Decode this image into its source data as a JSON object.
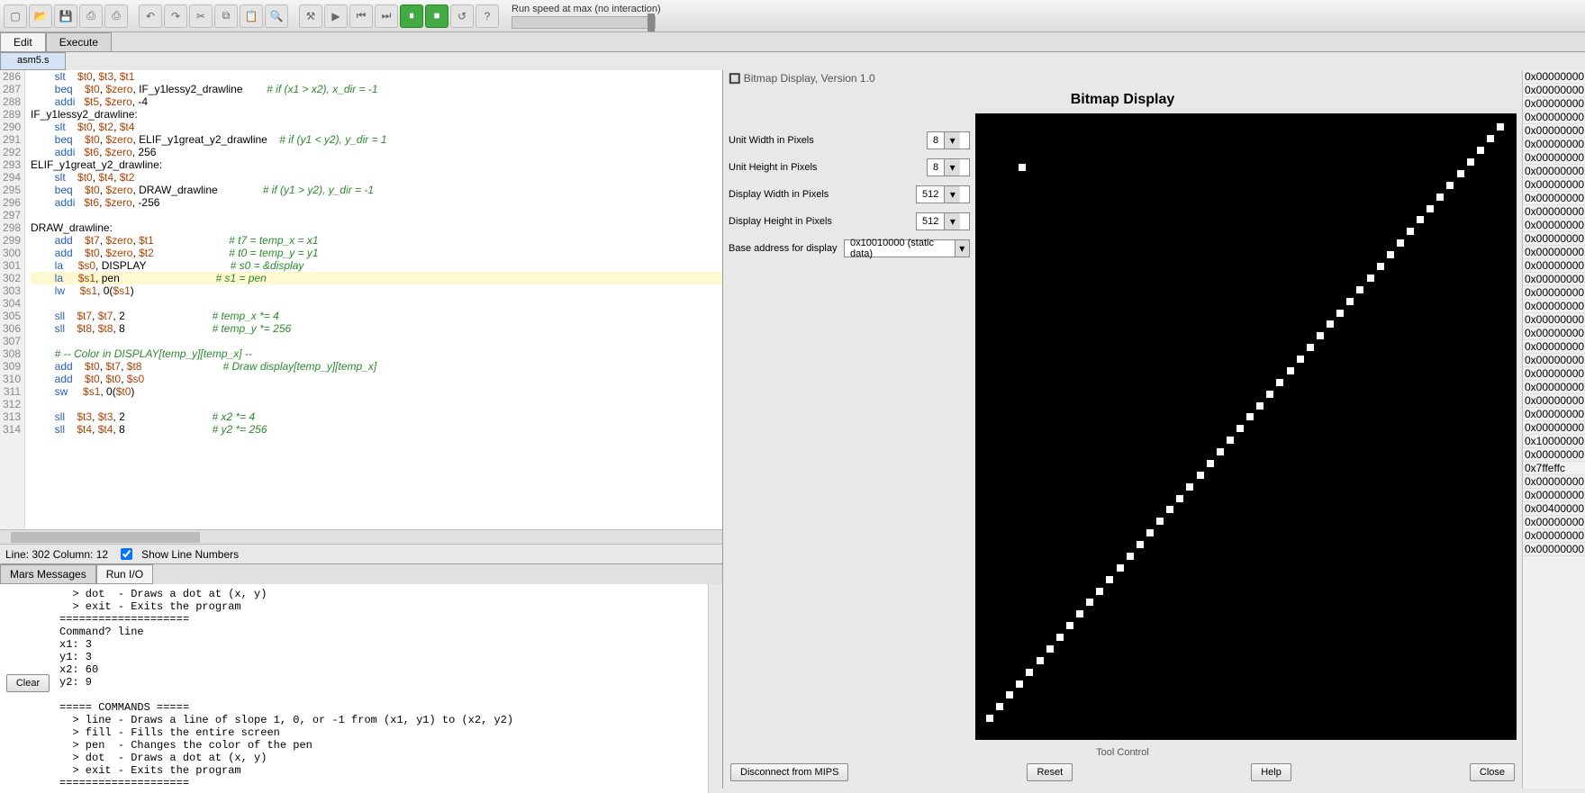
{
  "toolbar": {
    "speed_label": "Run speed at max (no interaction)"
  },
  "tabs": {
    "edit": "Edit",
    "execute": "Execute",
    "file": "asm5.s"
  },
  "editor": {
    "lines": [
      {
        "n": 286,
        "t": "        slt    $t0, $t3, $t1"
      },
      {
        "n": 287,
        "t": "        beq    $t0, $zero, IF_y1lessy2_drawline        # if (x1 > x2), x_dir = -1"
      },
      {
        "n": 288,
        "t": "        addi   $t5, $zero, -4"
      },
      {
        "n": 289,
        "t": "IF_y1lessy2_drawline:"
      },
      {
        "n": 290,
        "t": "        slt    $t0, $t2, $t4"
      },
      {
        "n": 291,
        "t": "        beq    $t0, $zero, ELIF_y1great_y2_drawline    # if (y1 < y2), y_dir = 1"
      },
      {
        "n": 292,
        "t": "        addi   $t6, $zero, 256"
      },
      {
        "n": 293,
        "t": "ELIF_y1great_y2_drawline:"
      },
      {
        "n": 294,
        "t": "        slt    $t0, $t4, $t2"
      },
      {
        "n": 295,
        "t": "        beq    $t0, $zero, DRAW_drawline               # if (y1 > y2), y_dir = -1"
      },
      {
        "n": 296,
        "t": "        addi   $t6, $zero, -256"
      },
      {
        "n": 297,
        "t": ""
      },
      {
        "n": 298,
        "t": "DRAW_drawline:"
      },
      {
        "n": 299,
        "t": "        add    $t7, $zero, $t1                         # t7 = temp_x = x1"
      },
      {
        "n": 300,
        "t": "        add    $t0, $zero, $t2                         # t0 = temp_y = y1"
      },
      {
        "n": 301,
        "t": "        la     $s0, DISPLAY                            # s0 = &display"
      },
      {
        "n": 302,
        "t": "        la     $s1, pen                                # s1 = pen",
        "hl": true
      },
      {
        "n": 303,
        "t": "        lw     $s1, 0($s1)"
      },
      {
        "n": 304,
        "t": ""
      },
      {
        "n": 305,
        "t": "        sll    $t7, $t7, 2                             # temp_x *= 4"
      },
      {
        "n": 306,
        "t": "        sll    $t8, $t8, 8                             # temp_y *= 256"
      },
      {
        "n": 307,
        "t": ""
      },
      {
        "n": 308,
        "t": "        # -- Color in DISPLAY[temp_y][temp_x] --"
      },
      {
        "n": 309,
        "t": "        add    $t0, $t7, $t8                           # Draw display[temp_y][temp_x]"
      },
      {
        "n": 310,
        "t": "        add    $t0, $t0, $s0"
      },
      {
        "n": 311,
        "t": "        sw     $s1, 0($t0)"
      },
      {
        "n": 312,
        "t": ""
      },
      {
        "n": 313,
        "t": "        sll    $t3, $t3, 2                             # x2 *= 4"
      },
      {
        "n": 314,
        "t": "        sll    $t4, $t4, 8                             # y2 *= 256"
      }
    ],
    "status": "Line: 302 Column: 12",
    "show_ln": "Show Line Numbers"
  },
  "console": {
    "tab_msgs": "Mars Messages",
    "tab_io": "Run I/O",
    "clear": "Clear",
    "text": "  > dot  - Draws a dot at (x, y)\n  > exit - Exits the program\n====================\nCommand? line\nx1: 3\ny1: 3\nx2: 60\ny2: 9\n\n===== COMMANDS =====\n  > line - Draws a line of slope 1, 0, or -1 from (x1, y1) to (x2, y2)\n  > fill - Fills the entire screen\n  > pen  - Changes the color of the pen\n  > dot  - Draws a dot at (x, y)\n  > exit - Exits the program\n===================="
  },
  "bitmap": {
    "win_title": "Bitmap Display, Version 1.0",
    "title": "Bitmap Display",
    "unit_w_lbl": "Unit Width in Pixels",
    "unit_w": "8",
    "unit_h_lbl": "Unit Height in Pixels",
    "unit_h": "8",
    "disp_w_lbl": "Display Width in Pixels",
    "disp_w": "512",
    "disp_h_lbl": "Display Height in Pixels",
    "disp_h": "512",
    "base_lbl": "Base address for display",
    "base": "0x10010000 (static data)",
    "tool_ctl": "Tool Control",
    "btn_disc": "Disconnect from MIPS",
    "btn_reset": "Reset",
    "btn_help": "Help",
    "btn_close": "Close"
  },
  "mem": {
    "rows": [
      "0x00000000",
      "0x00000000",
      "0x00000000",
      "0x00000000",
      "0x00000000",
      "0x00000000",
      "0x00000000",
      "0x00000000",
      "0x00000000",
      "0x00000000",
      "0x00000000",
      "0x00000000",
      "0x00000000",
      "0x00000000",
      "0x00000000",
      "0x00000000",
      "0x00000000",
      "0x00000000",
      "0x00000000",
      "0x00000000",
      "0x00000000",
      "0x00000000",
      "0x00000000",
      "0x00000000",
      "0x00000000",
      "0x00000000",
      "0x00000000",
      "0x10000000",
      "0x00000000",
      "0x7ffeffc",
      "0x00000000",
      "0x00000000",
      "0x00400000",
      "0x00000000",
      "0x00000000",
      "0x00000000"
    ]
  }
}
